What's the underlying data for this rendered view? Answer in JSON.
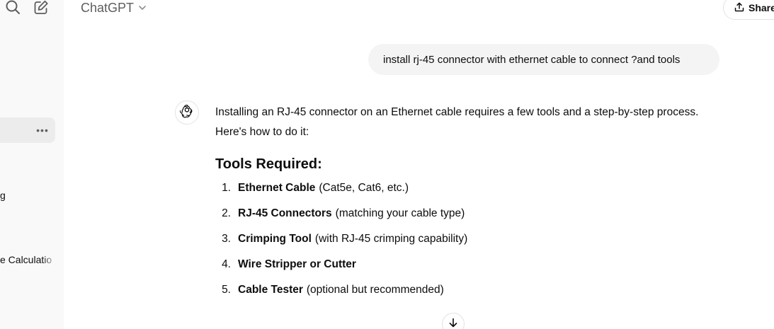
{
  "sidebar": {
    "icons": {
      "search": "search-icon",
      "compose": "compose-icon"
    },
    "more_label": "•••",
    "items": [
      {
        "label": "g"
      },
      {
        "label": "e Calculatio"
      }
    ]
  },
  "header": {
    "title": "ChatGPT",
    "share_label": "Share"
  },
  "conversation": {
    "user_message": "install rj-45 connector with ethernet cable to connect ?and tools",
    "assistant": {
      "intro_line1": "Installing an RJ-45 connector on an Ethernet cable requires a few tools and a step-by-step process.",
      "intro_line2": "Here's how to do it:",
      "heading": "Tools Required:",
      "tools": [
        {
          "num": "1.",
          "name": "Ethernet Cable",
          "detail": "(Cat5e, Cat6, etc.)"
        },
        {
          "num": "2.",
          "name": "RJ-45 Connectors",
          "detail": "(matching your cable type)"
        },
        {
          "num": "3.",
          "name": "Crimping Tool",
          "detail": "(with RJ-45 crimping capability)"
        },
        {
          "num": "4.",
          "name": "Wire Stripper or Cutter",
          "detail": ""
        },
        {
          "num": "5.",
          "name": "Cable Tester",
          "detail": "(optional but recommended)"
        }
      ]
    }
  }
}
